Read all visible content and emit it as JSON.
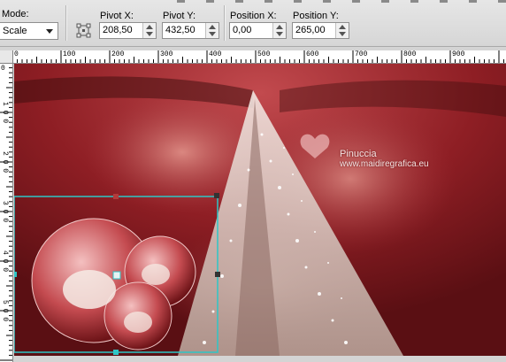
{
  "toolbar": {
    "mode": {
      "label": "Mode:",
      "value": "Scale"
    },
    "pivot_x": {
      "label": "Pivot X:",
      "value": "208,50"
    },
    "pivot_y": {
      "label": "Pivot Y:",
      "value": "432,50"
    },
    "position_x": {
      "label": "Position X:",
      "value": "0,00"
    },
    "position_y": {
      "label": "Position Y:",
      "value": "265,00"
    }
  },
  "ruler": {
    "horizontal": [
      "0",
      "100",
      "200",
      "300",
      "400",
      "500",
      "600",
      "700",
      "800",
      "900"
    ],
    "vertical": [
      "0",
      "1 0 0",
      "2 0 0",
      "3 0 0",
      "4 0 0",
      "5 0 0"
    ]
  },
  "watermark": {
    "line1": "Pinuccia",
    "line2": "www.maidiregrafica.eu"
  },
  "colors": {
    "selection": "#2ec6c6",
    "canvas_red": "#8a1a20"
  }
}
